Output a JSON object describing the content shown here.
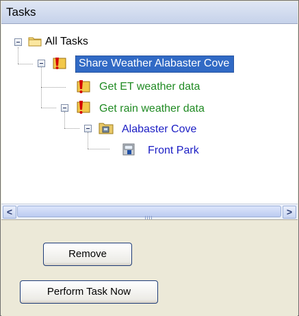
{
  "panel": {
    "title": "Tasks"
  },
  "tree": {
    "root": "All Tasks",
    "task": "Share Weather Alabaster Cove",
    "child1": "Get ET weather data",
    "child2": "Get rain weather data",
    "site": "Alabaster Cove",
    "controller": "Front Park"
  },
  "scroll": {
    "left_arrow": "<",
    "right_arrow": ">"
  },
  "buttons": {
    "remove": "Remove",
    "perform": "Perform Task Now"
  },
  "colors": {
    "selection": "#316ac5",
    "green_task": "#1f8a22",
    "blue_site": "#1b1dc4"
  },
  "icons": [
    "folder-icon",
    "warning-task-icon",
    "site-icon",
    "controller-icon"
  ]
}
